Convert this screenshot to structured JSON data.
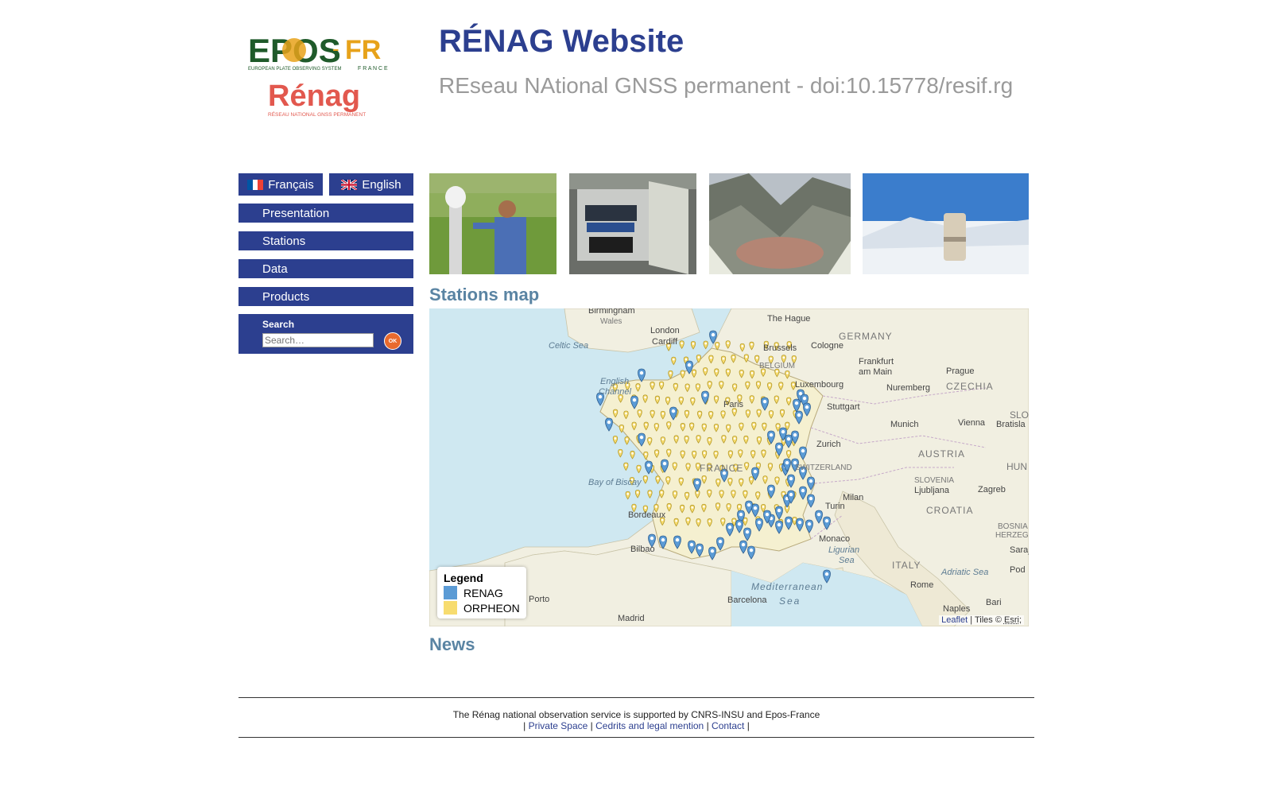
{
  "header": {
    "title": "RÉNAG Website",
    "subtitle": "REseau NAtional GNSS permanent - doi:10.15778/resif.rg",
    "logo_epos": "EPOS",
    "logo_fr": "FR",
    "logo_epos_tagline": "EUROPEAN PLATE OBSERVING SYSTEM",
    "logo_france": "F R A N C E",
    "logo_renag": "Rénag",
    "logo_renag_tagline": "RÉSEAU NATIONAL GNSS PERMANENT"
  },
  "language": {
    "french": "Français",
    "english": "English"
  },
  "nav": {
    "presentation": "Presentation",
    "stations": "Stations",
    "data": "Data",
    "products": "Products"
  },
  "search": {
    "label": "Search",
    "placeholder": "Search…",
    "button": "OK"
  },
  "stations_map": {
    "title": "Stations map",
    "legend_title": "Legend",
    "legend_renag": "RENAG",
    "legend_orpheon": "ORPHEON",
    "color_renag": "#5b9bd5",
    "color_orpheon": "#f7dc6f",
    "attribution_leaflet": "Leaflet",
    "attribution_tiles": " | Tiles © ",
    "attribution_esri": "Esri",
    "attribution_end": ";",
    "labels": {
      "birmingham": "Birmingham",
      "wales": "Wales",
      "london": "London",
      "cardiff": "Cardiff",
      "the_hague": "The Hague",
      "germany": "GERMANY",
      "celtic_sea": "Celtic Sea",
      "brussels": "Brussels",
      "cologne": "Cologne",
      "belgium": "BELGIUM",
      "frankfurt": "Frankfurt",
      "am_main": "am Main",
      "prague": "Prague",
      "english": "English",
      "channel": "Channel",
      "luxembourg": "Luxembourg",
      "nuremberg": "Nuremberg",
      "czechia": "CZECHIA",
      "paris": "Paris",
      "stuttgart": "Stuttgart",
      "munich": "Munich",
      "vienna": "Vienna",
      "bratislava": "Bratisla",
      "zurich": "Zurich",
      "france": "FRANCE",
      "switzerland": "SWITZERLAND",
      "austria": "AUSTRIA",
      "hungary": "HUN",
      "bay_of_biscay": "Bay of Biscay",
      "slovenia": "SLOVENIA",
      "ljubljana": "Ljubljana",
      "zagreb": "Zagreb",
      "milan": "Milan",
      "turin": "Turin",
      "croatia": "CROATIA",
      "bosnia": "BOSNIA AN",
      "herzegovina": "HERZEGOVI",
      "bordeaux": "Bordeaux",
      "monaco": "Monaco",
      "ligurian": "Ligurian",
      "sea": "Sea",
      "bilbao": "Bilbao",
      "sarajevo": "Saraj",
      "italy": "ITALY",
      "adriatic": "Adriatic Sea",
      "porto": "Porto",
      "rome": "Rome",
      "podgorica": "Pod",
      "mediterranean": "Mediterranean",
      "mediterranean_sea": "Sea",
      "barcelona": "Barcelona",
      "naples": "Naples",
      "bari": "Bari",
      "madrid": "Madrid",
      "slovakia": "SLO"
    }
  },
  "news": {
    "title": "News"
  },
  "footer": {
    "support_text": "The Rénag national observation service is supported by CNRS-INSU and Epos-France",
    "sep": "|",
    "private_space": "Private Space",
    "legal": "Cedrits and legal mention",
    "contact": "Contact"
  }
}
